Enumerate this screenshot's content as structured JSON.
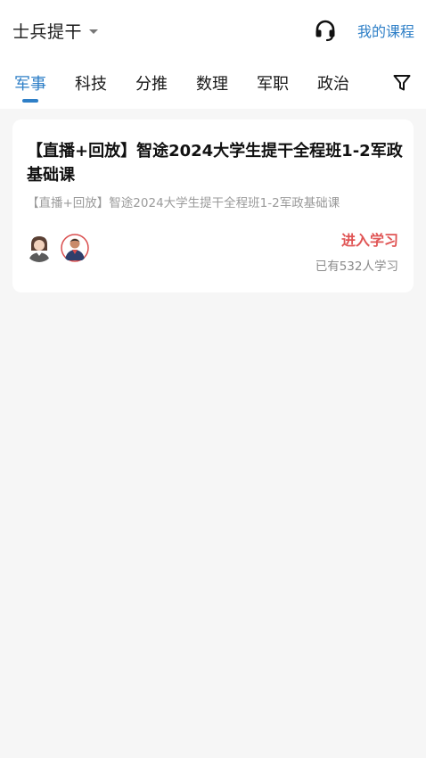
{
  "header": {
    "category": "士兵提干",
    "my_courses": "我的课程",
    "icons": {
      "dropdown": "caret-down-icon",
      "support": "headset-icon",
      "filter": "filter-icon"
    }
  },
  "tabs": [
    {
      "label": "军事",
      "active": true
    },
    {
      "label": "科技",
      "active": false
    },
    {
      "label": "分推",
      "active": false
    },
    {
      "label": "数理",
      "active": false
    },
    {
      "label": "军职",
      "active": false
    },
    {
      "label": "政治",
      "active": false
    }
  ],
  "courses": [
    {
      "title": "【直播+回放】智途2024大学生提干全程班1-2军政基础课",
      "subtitle": "【直播+回放】智途2024大学生提干全程班1-2军政基础课",
      "action": "进入学习",
      "learners": "已有532人学习",
      "avatars": [
        "teacher-avatar-female",
        "teacher-avatar-male"
      ]
    }
  ],
  "colors": {
    "accent": "#2e7fc7",
    "action": "#e05555",
    "background": "#f6f6f6"
  }
}
